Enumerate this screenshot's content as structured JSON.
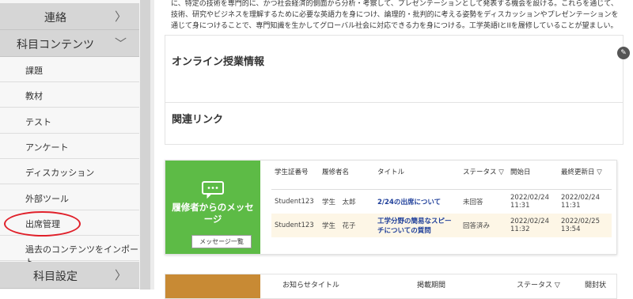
{
  "sidebar": {
    "sections": [
      {
        "label": "連絡",
        "chevron": "〉"
      },
      {
        "label": "科目コンテンツ",
        "chevron": "﹀"
      },
      {
        "label": "科目設定",
        "chevron": "〉"
      }
    ],
    "items": [
      "課題",
      "教材",
      "テスト",
      "アンケート",
      "ディスカッション",
      "外部ツール",
      "出席管理",
      "過去のコンテンツをインポート"
    ],
    "highlight_color": "#e0202a"
  },
  "course_description": "に、特定の技術を専門的に、かつ社会経済的側面から分析・考察して、プレゼンテーションとして発表する機会を設ける。これらを通じて、技術、研究やビジネスを理解するために必要な英語力を身につけ、論理的・批判的に考える姿勢をディスカッションやプレゼンテーションを通じて身につけることで、専門知識を生かしてグローバル社会に対応できる力を身につける。工学英語IとIIを履修していることが望ましい。",
  "online_class": {
    "title": "オンライン授業情報"
  },
  "related_links": {
    "title": "関連リンク"
  },
  "messages": {
    "title": "履修者からのメッセージ",
    "button": "メッセージ一覧",
    "columns": [
      "学生証番号",
      "履修者名",
      "タイトル",
      "ステータス ▽",
      "開始日",
      "最終更新日 ▽"
    ],
    "rows": [
      {
        "id": "Student123",
        "name": "学生　太郎",
        "title": "2/24の出席について",
        "status": "未回答",
        "start": "2022/02/24 11:31",
        "updated": "2022/02/24 11:31"
      },
      {
        "id": "Student123",
        "name": "学生　花子",
        "title": "工学分野の簡易なスピーチについての質問",
        "status": "回答済み",
        "start": "2022/02/24 11:32",
        "updated": "2022/02/25 13:54"
      }
    ]
  },
  "notices": {
    "columns": [
      "お知らせタイトル",
      "掲載期間",
      "ステータス ▽",
      "開封状"
    ]
  },
  "colors": {
    "green": "#5dbb46",
    "orange": "#c88a34",
    "link": "#1f3f9a"
  }
}
